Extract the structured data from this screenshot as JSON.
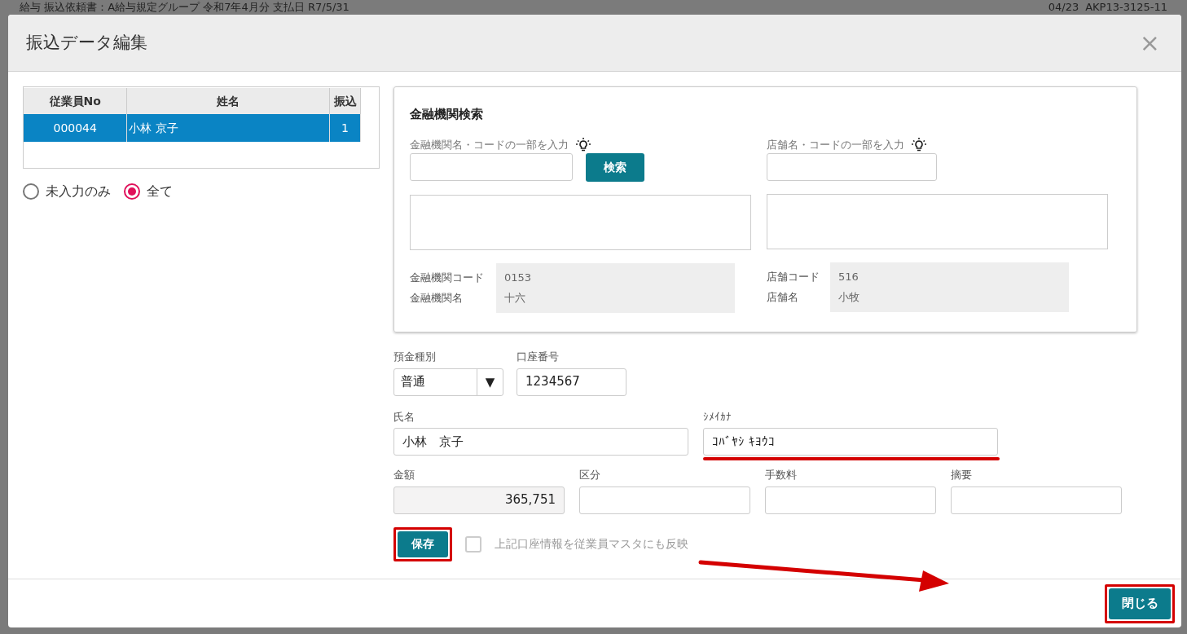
{
  "background_header": {
    "title": "給与 振込依頼書：A給与規定グループ 令和7年4月分 支払日 R7/5/31",
    "date": "04/23",
    "code": "AKP13-3125-11"
  },
  "dialog": {
    "title": "振込データ編集",
    "close_symbol": "×"
  },
  "employee_table": {
    "columns": [
      "従業員No",
      "姓名",
      "振込"
    ],
    "rows": [
      {
        "cells": [
          "000044",
          "小林 京子",
          "1"
        ],
        "selected": true
      }
    ]
  },
  "filter_options": [
    {
      "label": "未入力のみ",
      "selected": false
    },
    {
      "label": "全て",
      "selected": true
    }
  ],
  "bank_search": {
    "title": "金融機関検索",
    "bank_query_label": "金融機関名・コードの一部を入力",
    "search_button": "検索",
    "branch_query_label": "店舗名・コードの一部を入力",
    "bank_info": [
      {
        "label": "金融機関コード",
        "value": "0153"
      },
      {
        "label": "金融機関名",
        "value": "十六"
      }
    ],
    "branch_info": [
      {
        "label": "店舗コード",
        "value": "516"
      },
      {
        "label": "店舗名",
        "value": "小牧"
      }
    ]
  },
  "account": {
    "deposit_type": {
      "label": "預金種別",
      "value": "普通",
      "arrow": "▼"
    },
    "account_number": {
      "label": "口座番号",
      "value": "1234567"
    }
  },
  "name_fields": [
    {
      "label": "氏名",
      "value": "小林　京子",
      "underlined": false
    },
    {
      "label": "ｼﾒｲｶﾅ",
      "value": "ｺﾊﾞﾔｼ ｷﾖｳｺ",
      "underlined": true
    }
  ],
  "amount_fields": [
    {
      "label": "金額",
      "value": "365,751",
      "disabled": true
    },
    {
      "label": "区分",
      "disabled": false
    },
    {
      "label": "手数料",
      "disabled": false
    },
    {
      "label": "摘要",
      "disabled": false
    }
  ],
  "save_button": {
    "label": "保存",
    "highlighted": true
  },
  "sync_checkbox": {
    "label": "上記口座情報を従業員マスタにも反映",
    "checked": false,
    "disabled": true
  },
  "close_button": {
    "label": "閉じる",
    "highlighted": true
  },
  "annotation_arrow": true
}
